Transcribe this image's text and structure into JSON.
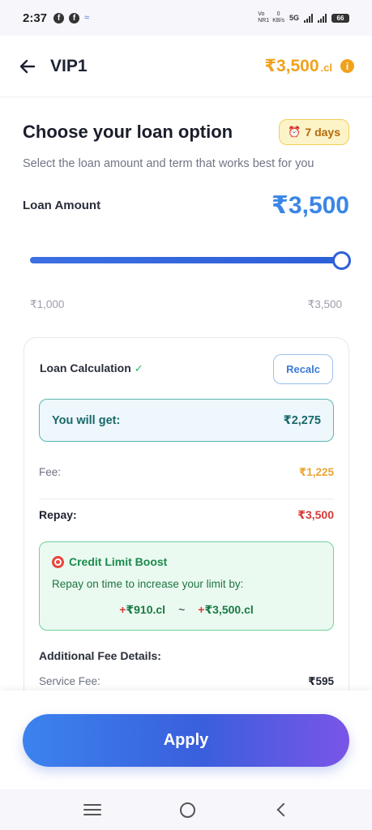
{
  "status_bar": {
    "time": "2:37",
    "network_label": "5G",
    "data_rate_value": "0",
    "data_rate_unit": "KB/s",
    "volte_label": "Vo NR1",
    "battery": "66"
  },
  "header": {
    "title": "VIP1",
    "balance": "₹3,500",
    "balance_unit": ".cl",
    "accent_color": "#f0a21d"
  },
  "loan": {
    "title": "Choose your loan option",
    "days_badge": "7 days",
    "subtitle": "Select the loan amount and term that works best for you",
    "amount_label": "Loan Amount",
    "amount_value": "₹3,500",
    "slider_min_label": "₹1,000",
    "slider_max_label": "₹3,500",
    "slider_fraction": 1.0
  },
  "calculation": {
    "title": "Loan Calculation",
    "recalc_label": "Recalc",
    "you_get_label": "You will get:",
    "you_get_value": "₹2,275",
    "fee_label": "Fee:",
    "fee_value": "₹1,225",
    "repay_label": "Repay:",
    "repay_value": "₹3,500"
  },
  "boost": {
    "title": "Credit Limit Boost",
    "text": "Repay on time to increase your limit by:",
    "plus": "+",
    "range_min": "₹910.cl",
    "separator": "~",
    "range_max": "₹3,500.cl"
  },
  "additional": {
    "title": "Additional Fee Details:",
    "service_fee_label": "Service Fee:",
    "service_fee_value": "₹595"
  },
  "footer": {
    "apply_label": "Apply"
  }
}
